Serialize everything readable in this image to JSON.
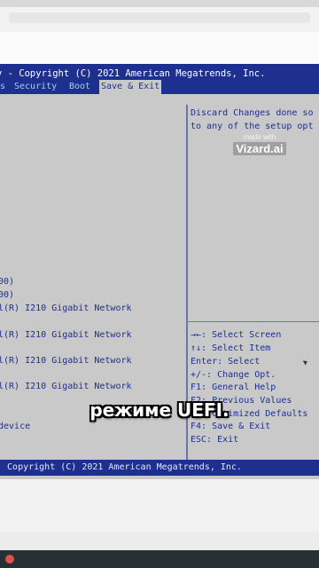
{
  "bios": {
    "title": "y - Copyright (C) 2021 American Megatrends, Inc.",
    "menu": [
      "s",
      "Security",
      "Boot",
      "Save & Exit"
    ],
    "active_menu": "Save & Exit",
    "left_lines": [
      "00)",
      "00)",
      "l(R) I210 Gigabit  Network",
      "l(R) I210 Gigabit  Network",
      "l(R) I210 Gigabit  Network",
      "l(R) I210 Gigabit  Network",
      " device"
    ],
    "help_text": [
      "Discard Changes done so",
      "to any of the setup opt"
    ],
    "key_help": [
      "→←: Select Screen",
      "↑↓: Select Item",
      "Enter: Select",
      "+/-: Change Opt.",
      "F1: General Help",
      "F2: Previous Values",
      "F3: Optimized Defaults",
      "F4: Save & Exit",
      "ESC: Exit"
    ],
    "footer": ". Copyright (C) 2021 American Megatrends, Inc."
  },
  "watermark": {
    "small": "made with",
    "brand": "Vizard.ai"
  },
  "caption": "режиме UEFI."
}
